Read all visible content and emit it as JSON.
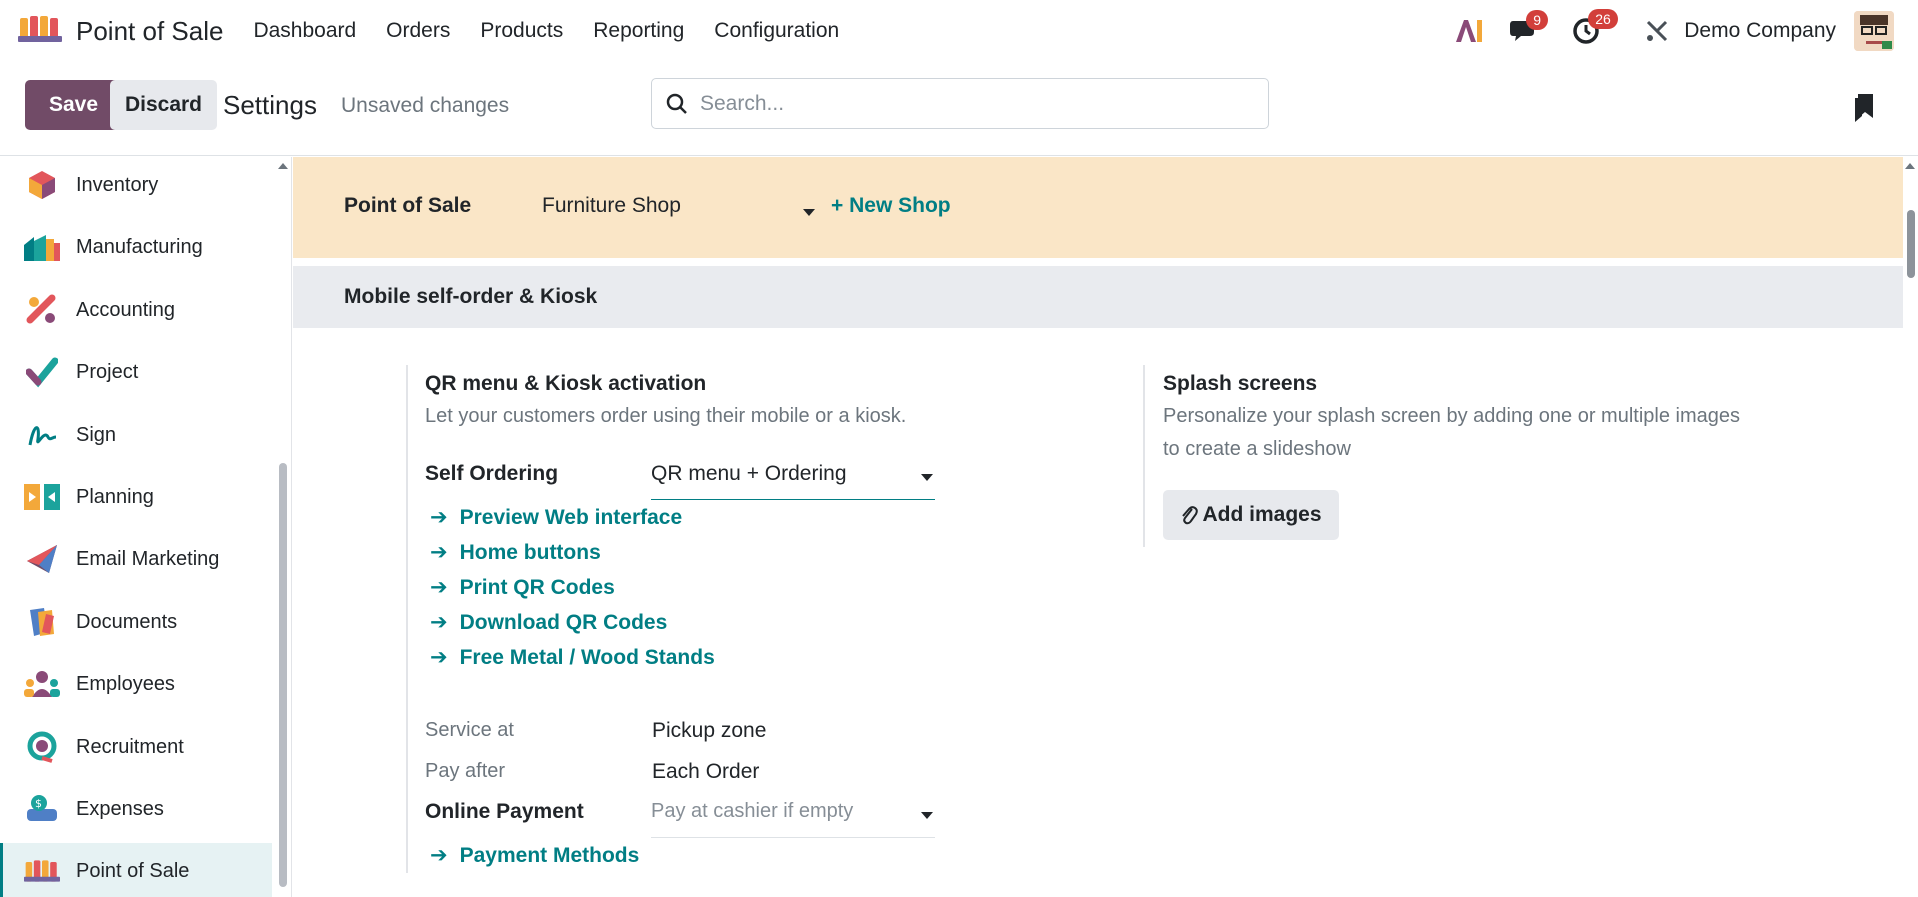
{
  "navbar": {
    "app_name": "Point of Sale",
    "menu": [
      "Dashboard",
      "Orders",
      "Products",
      "Reporting",
      "Configuration"
    ],
    "messages_count": "9",
    "activities_count": "26",
    "company": "Demo Company"
  },
  "control": {
    "save_label": "Save",
    "discard_label": "Discard",
    "title": "Settings",
    "status": "Unsaved changes",
    "search_placeholder": "Search..."
  },
  "sidebar": {
    "items": [
      {
        "label": "Inventory",
        "icon": "inventory-icon"
      },
      {
        "label": "Manufacturing",
        "icon": "manufacturing-icon"
      },
      {
        "label": "Accounting",
        "icon": "accounting-icon"
      },
      {
        "label": "Project",
        "icon": "project-icon"
      },
      {
        "label": "Sign",
        "icon": "sign-icon"
      },
      {
        "label": "Planning",
        "icon": "planning-icon"
      },
      {
        "label": "Email Marketing",
        "icon": "email-marketing-icon"
      },
      {
        "label": "Documents",
        "icon": "documents-icon"
      },
      {
        "label": "Employees",
        "icon": "employees-icon"
      },
      {
        "label": "Recruitment",
        "icon": "recruitment-icon"
      },
      {
        "label": "Expenses",
        "icon": "expenses-icon"
      },
      {
        "label": "Point of Sale",
        "icon": "point-of-sale-icon",
        "active": true
      }
    ]
  },
  "pos_band": {
    "label": "Point of Sale",
    "shop": "Furniture Shop",
    "new_shop": "+ New Shop"
  },
  "section": {
    "title": "Mobile self-order & Kiosk"
  },
  "qr_setting": {
    "title": "QR menu & Kiosk activation",
    "description": "Let your customers order using their mobile or a kiosk.",
    "self_ordering_label": "Self Ordering",
    "self_ordering_value": "QR menu + Ordering",
    "links": [
      "Preview Web interface",
      "Home buttons",
      "Print QR Codes",
      "Download QR Codes",
      "Free Metal / Wood Stands"
    ],
    "service_at_label": "Service at",
    "service_at_value": "Pickup zone",
    "pay_after_label": "Pay after",
    "pay_after_value": "Each Order",
    "online_payment_label": "Online Payment",
    "online_payment_placeholder": "Pay at cashier if empty",
    "payment_methods_link": "Payment Methods"
  },
  "splash_setting": {
    "title": "Splash screens",
    "description_line1": "Personalize your splash screen by adding one or multiple images",
    "description_line2": "to create a slideshow",
    "add_images_label": "Add images"
  },
  "colors": {
    "primary": "#714b67",
    "link": "#017e84",
    "band": "#fae6c7",
    "section": "#e9ebef",
    "badge": "#d23f3a"
  }
}
